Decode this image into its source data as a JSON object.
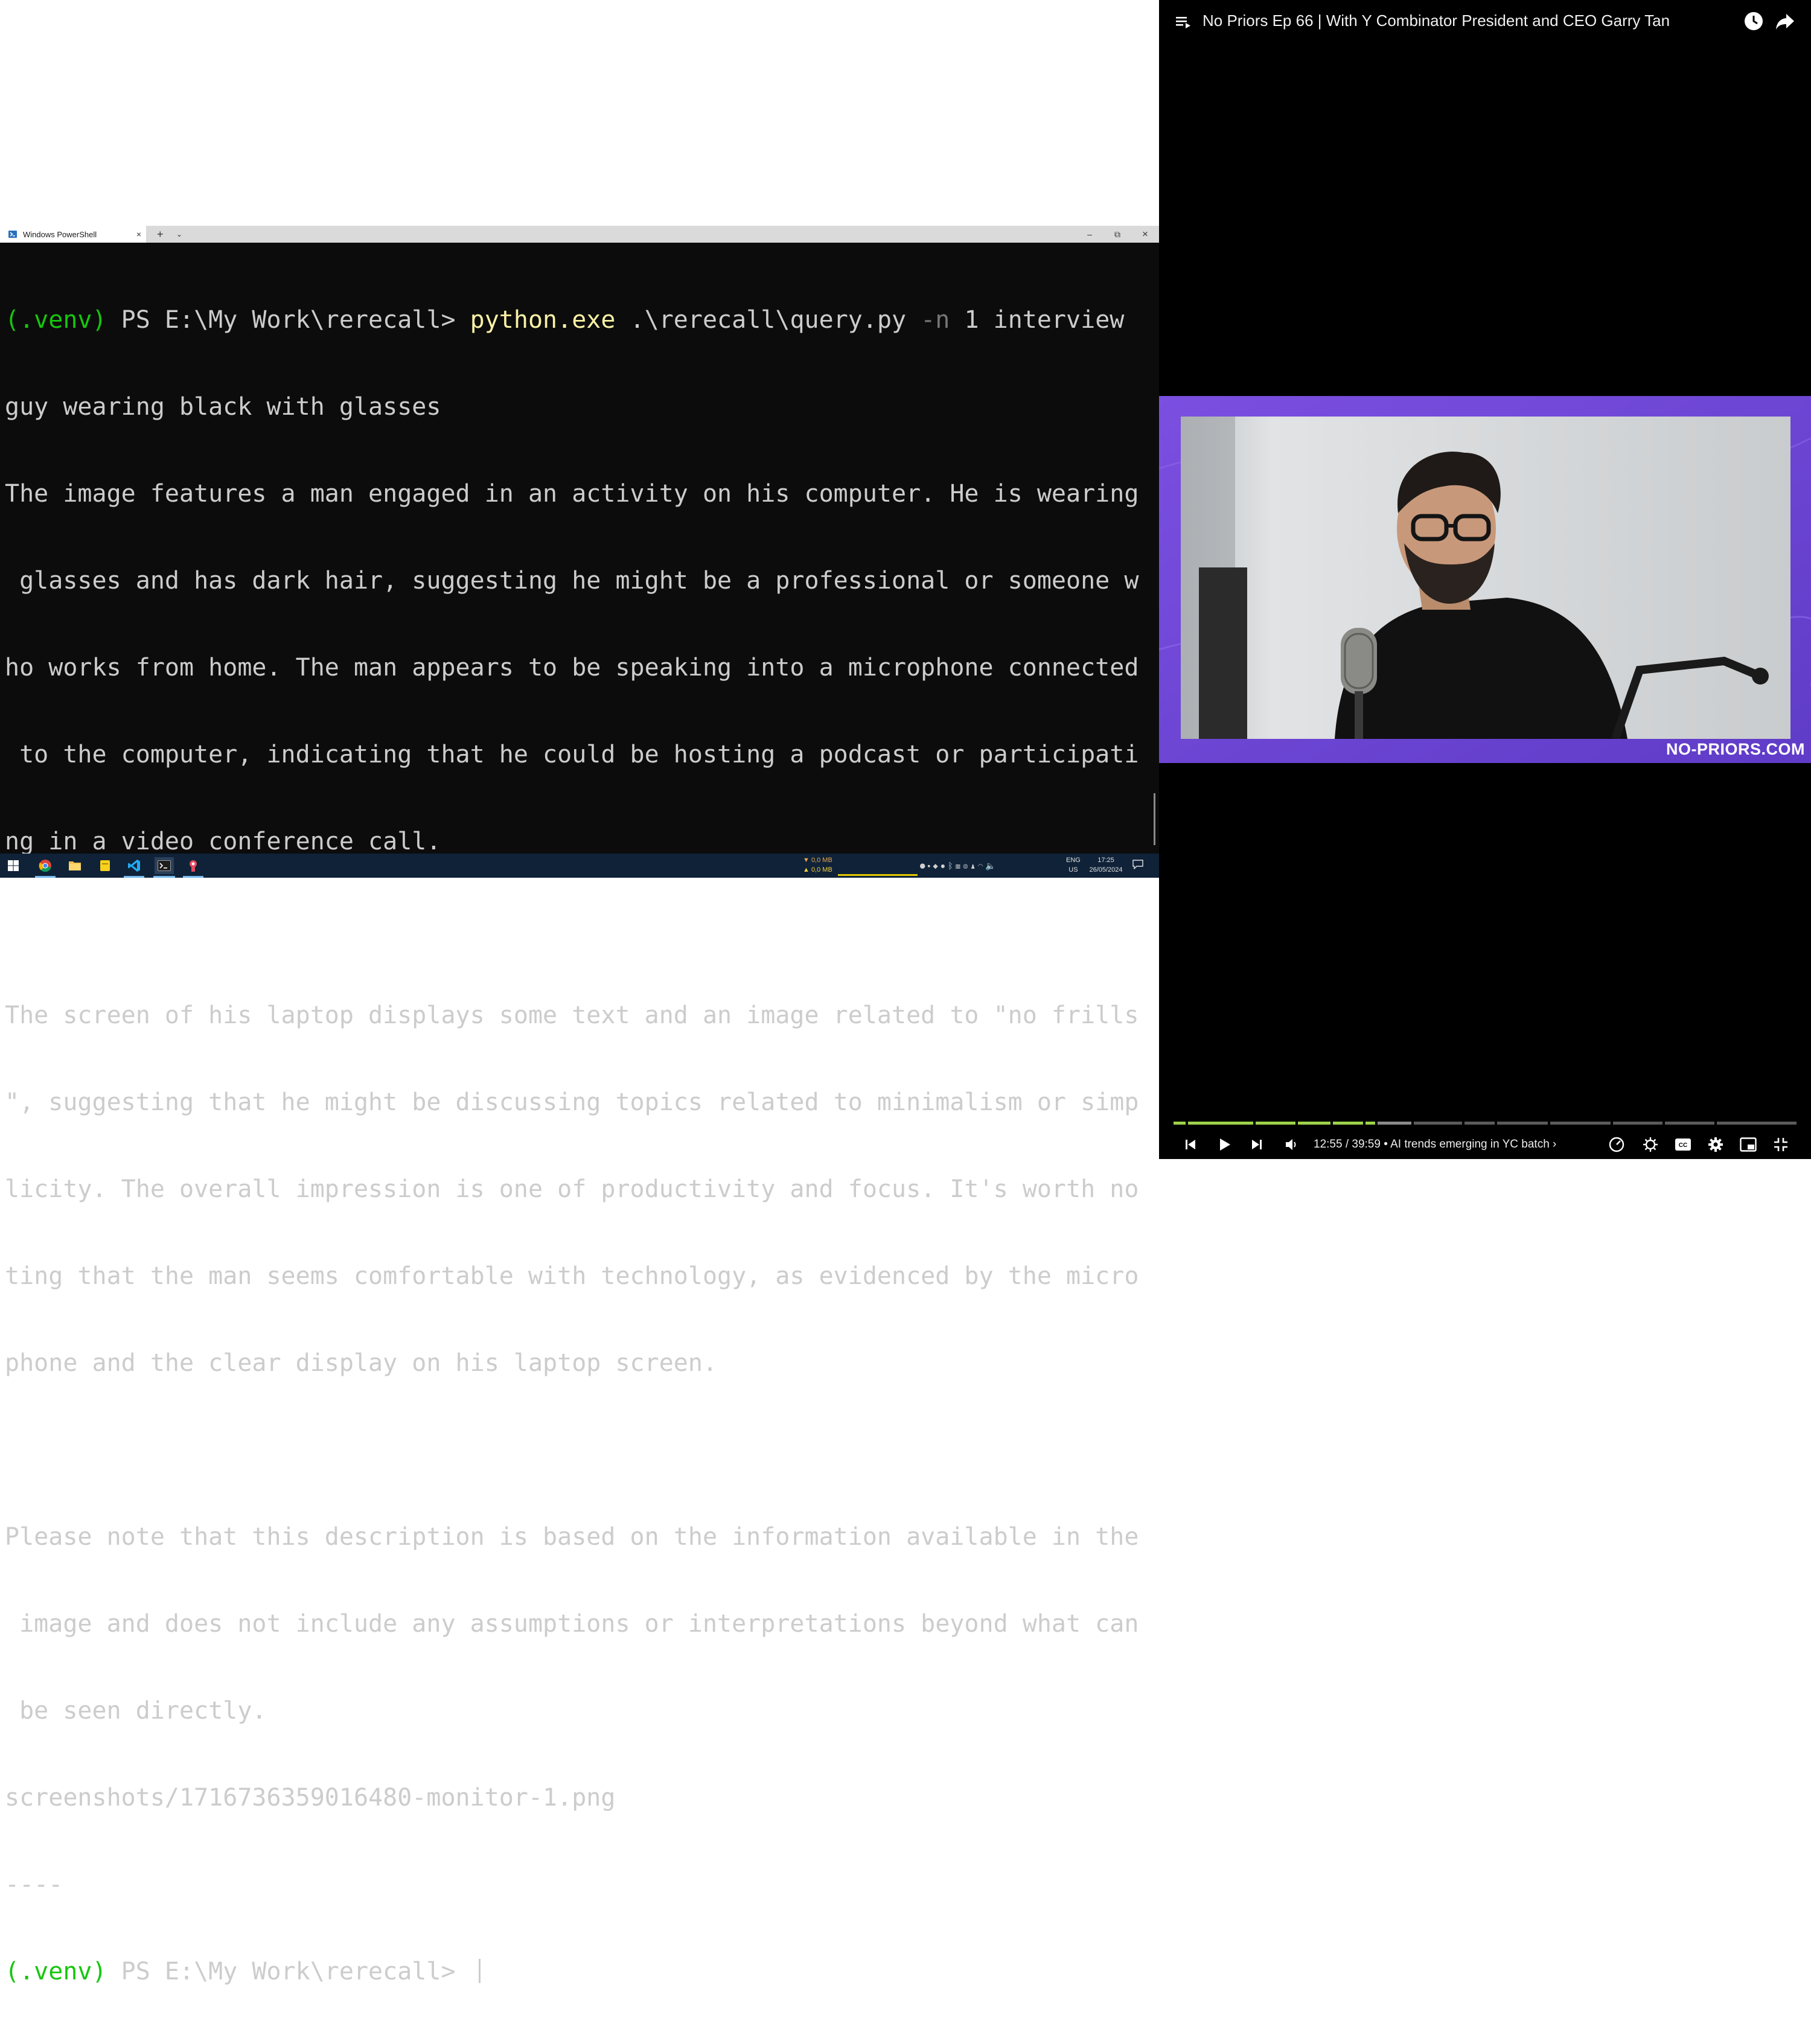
{
  "powershell": {
    "tab_title": "Windows PowerShell",
    "tab_close": "×",
    "new_tab": "+",
    "tab_dropdown": "⌄",
    "window_controls": {
      "minimize": "–",
      "maximize": "⧉",
      "close": "×"
    },
    "command": {
      "venv": "(.venv)",
      "prompt": " PS E:\\My Work\\rerecall> ",
      "exe": "python.exe",
      "script": " .\\rerecall\\query.py ",
      "flag": "-n",
      "arg": " 1 interview",
      "continuation": "guy wearing black with glasses"
    },
    "output_lines": [
      "The image features a man engaged in an activity on his computer. He is wearing",
      " glasses and has dark hair, suggesting he might be a professional or someone w",
      "ho works from home. The man appears to be speaking into a microphone connected",
      " to the computer, indicating that he could be hosting a podcast or participati",
      "ng in a video conference call.",
      "",
      "The screen of his laptop displays some text and an image related to \"no frills",
      "\", suggesting that he might be discussing topics related to minimalism or simp",
      "licity. The overall impression is one of productivity and focus. It's worth no",
      "ting that the man seems comfortable with technology, as evidenced by the micro",
      "phone and the clear display on his laptop screen.",
      "",
      "Please note that this description is based on the information available in the",
      " image and does not include any assumptions or interpretations beyond what can",
      " be seen directly.",
      "screenshots/1716736359016480-monitor-1.png",
      "----"
    ],
    "final_prompt": {
      "venv": "(.venv)",
      "prompt": " PS E:\\My Work\\rerecall> "
    }
  },
  "taskbar": {
    "net_down": "▼ 0,0 MB",
    "net_up": "▲ 0,0 MB",
    "lang_1": "ENG",
    "lang_2": "US",
    "time": "17:25",
    "date": "26/05/2024",
    "icons": [
      "windows-start-icon",
      "chrome-icon",
      "file-explorer-icon",
      "sticky-notes-icon",
      "vscode-icon",
      "terminal-icon",
      "app-icon"
    ]
  },
  "youtube": {
    "title": "No Priors Ep 66 | With Y Combinator President and CEO Garry Tan",
    "brand_watermark": "NO-PRIORS.COM",
    "time_current": "12:55",
    "time_total": "39:59",
    "chapter": "AI trends emerging in YC batch",
    "time_display": "12:55 / 39:59 • AI trends emerging in YC batch ›",
    "played_fraction": 0.323,
    "icons": [
      "playlist-icon",
      "watch-later-icon",
      "share-icon",
      "previous-icon",
      "play-icon",
      "next-icon",
      "volume-icon",
      "speed-icon",
      "autoplay-icon",
      "captions-icon",
      "settings-icon",
      "miniplayer-icon",
      "exit-fullscreen-icon"
    ]
  }
}
